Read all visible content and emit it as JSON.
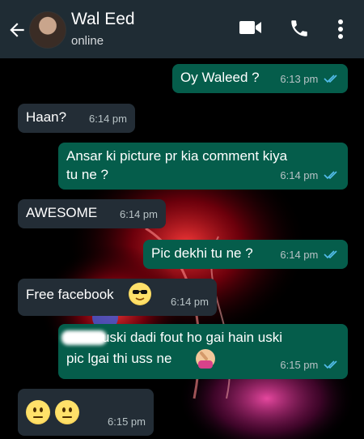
{
  "header": {
    "contact_name": "Wal Eed",
    "status": "online"
  },
  "messages": [
    {
      "direction": "outgoing",
      "text": "Oy Waleed ?",
      "time": "6:13 pm",
      "status": "read"
    },
    {
      "direction": "incoming",
      "text": "Haan?",
      "time": "6:14 pm"
    },
    {
      "direction": "outgoing",
      "text_line1": "Ansar ki picture pr kia comment kiya",
      "text_line2": "tu ne ?",
      "time": "6:14 pm",
      "status": "read"
    },
    {
      "direction": "incoming",
      "text": "AWESOME",
      "time": "6:14 pm"
    },
    {
      "direction": "outgoing",
      "text": "Pic dekhi tu ne ?",
      "time": "6:14 pm",
      "status": "read"
    },
    {
      "direction": "incoming",
      "text": "Free facebook",
      "emoji": "sunglasses-face",
      "time": "6:14 pm"
    },
    {
      "direction": "outgoing",
      "text_line1": "uski dadi fout ho gai hain uski",
      "text_line2": "pic lgai thi uss ne",
      "emoji": "facepalm",
      "time": "6:15 pm",
      "status": "read"
    },
    {
      "direction": "incoming",
      "emoji": "neutral-face-x2",
      "time": "6:15 pm"
    }
  ],
  "colors": {
    "header_bg": "#1f2c34",
    "outgoing_bubble": "#055d4b",
    "incoming_bubble": "#232d36",
    "read_tick": "#53bdeb"
  }
}
